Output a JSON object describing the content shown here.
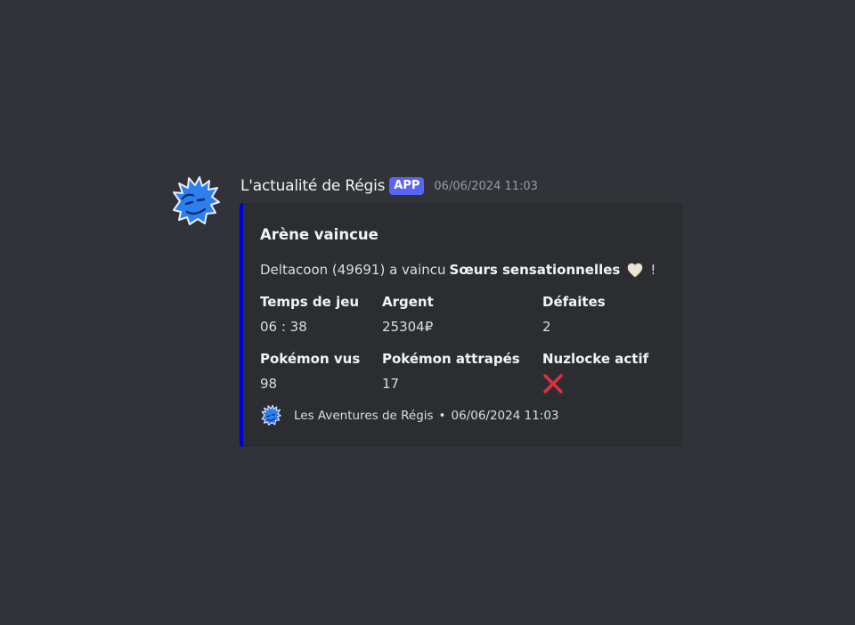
{
  "message": {
    "username": "L'actualité de Régis",
    "badge": "APP",
    "timestamp": "06/06/2024 11:03",
    "avatar_icon": "blue-hedgehog-avatar-icon"
  },
  "embed": {
    "accent_color": "#0000d6",
    "title": "Arène vaincue",
    "description": {
      "prefix": "Deltacoon (49691) a vaincu",
      "bold": "Sœurs sensationnelles",
      "emoji": "white-heart-icon",
      "suffix": "!"
    },
    "fields": [
      {
        "name": "Temps de jeu",
        "value": "06 : 38"
      },
      {
        "name": "Argent",
        "value": "25304₽"
      },
      {
        "name": "Défaites",
        "value": "2"
      },
      {
        "name": "Pokémon vus",
        "value": "98"
      },
      {
        "name": "Pokémon attrapés",
        "value": "17"
      },
      {
        "name": "Nuzlocke actif",
        "value": "cross-mark-icon"
      }
    ],
    "footer": {
      "text": "Les Aventures de Régis",
      "separator": "•",
      "timestamp": "06/06/2024 11:03",
      "icon": "blue-hedgehog-footer-icon"
    }
  }
}
